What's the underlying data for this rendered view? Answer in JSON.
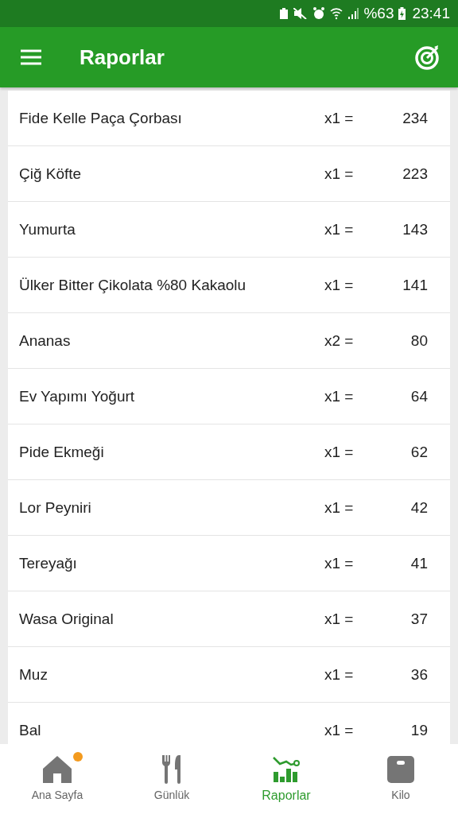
{
  "status_bar": {
    "battery": "%63",
    "time": "23:41"
  },
  "app_bar": {
    "title": "Raporlar"
  },
  "rows": [
    {
      "name": "Fide Kelle Paça Çorbası",
      "qty": "x1 =",
      "value": "234"
    },
    {
      "name": "Çiğ Köfte",
      "qty": "x1 =",
      "value": "223"
    },
    {
      "name": "Yumurta",
      "qty": "x1 =",
      "value": "143"
    },
    {
      "name": "Ülker Bitter Çikolata %80 Kakaolu",
      "qty": "x1 =",
      "value": "141"
    },
    {
      "name": "Ananas",
      "qty": "x2 =",
      "value": "80"
    },
    {
      "name": "Ev Yapımı Yoğurt",
      "qty": "x1 =",
      "value": "64"
    },
    {
      "name": "Pide Ekmeği",
      "qty": "x1 =",
      "value": "62"
    },
    {
      "name": "Lor Peyniri",
      "qty": "x1 =",
      "value": "42"
    },
    {
      "name": "Tereyağı",
      "qty": "x1 =",
      "value": "41"
    },
    {
      "name": "Wasa Original",
      "qty": "x1 =",
      "value": "37"
    },
    {
      "name": "Muz",
      "qty": "x1 =",
      "value": "36"
    },
    {
      "name": "Bal",
      "qty": "x1 =",
      "value": "19"
    }
  ],
  "bottom_nav": [
    {
      "kind": "home",
      "label": "Ana Sayfa",
      "selected": false,
      "badge": true
    },
    {
      "kind": "diary",
      "label": "Günlük",
      "selected": false,
      "badge": false
    },
    {
      "kind": "reports",
      "label": "Raporlar",
      "selected": true,
      "badge": false
    },
    {
      "kind": "weight",
      "label": "Kilo",
      "selected": false,
      "badge": false
    }
  ]
}
